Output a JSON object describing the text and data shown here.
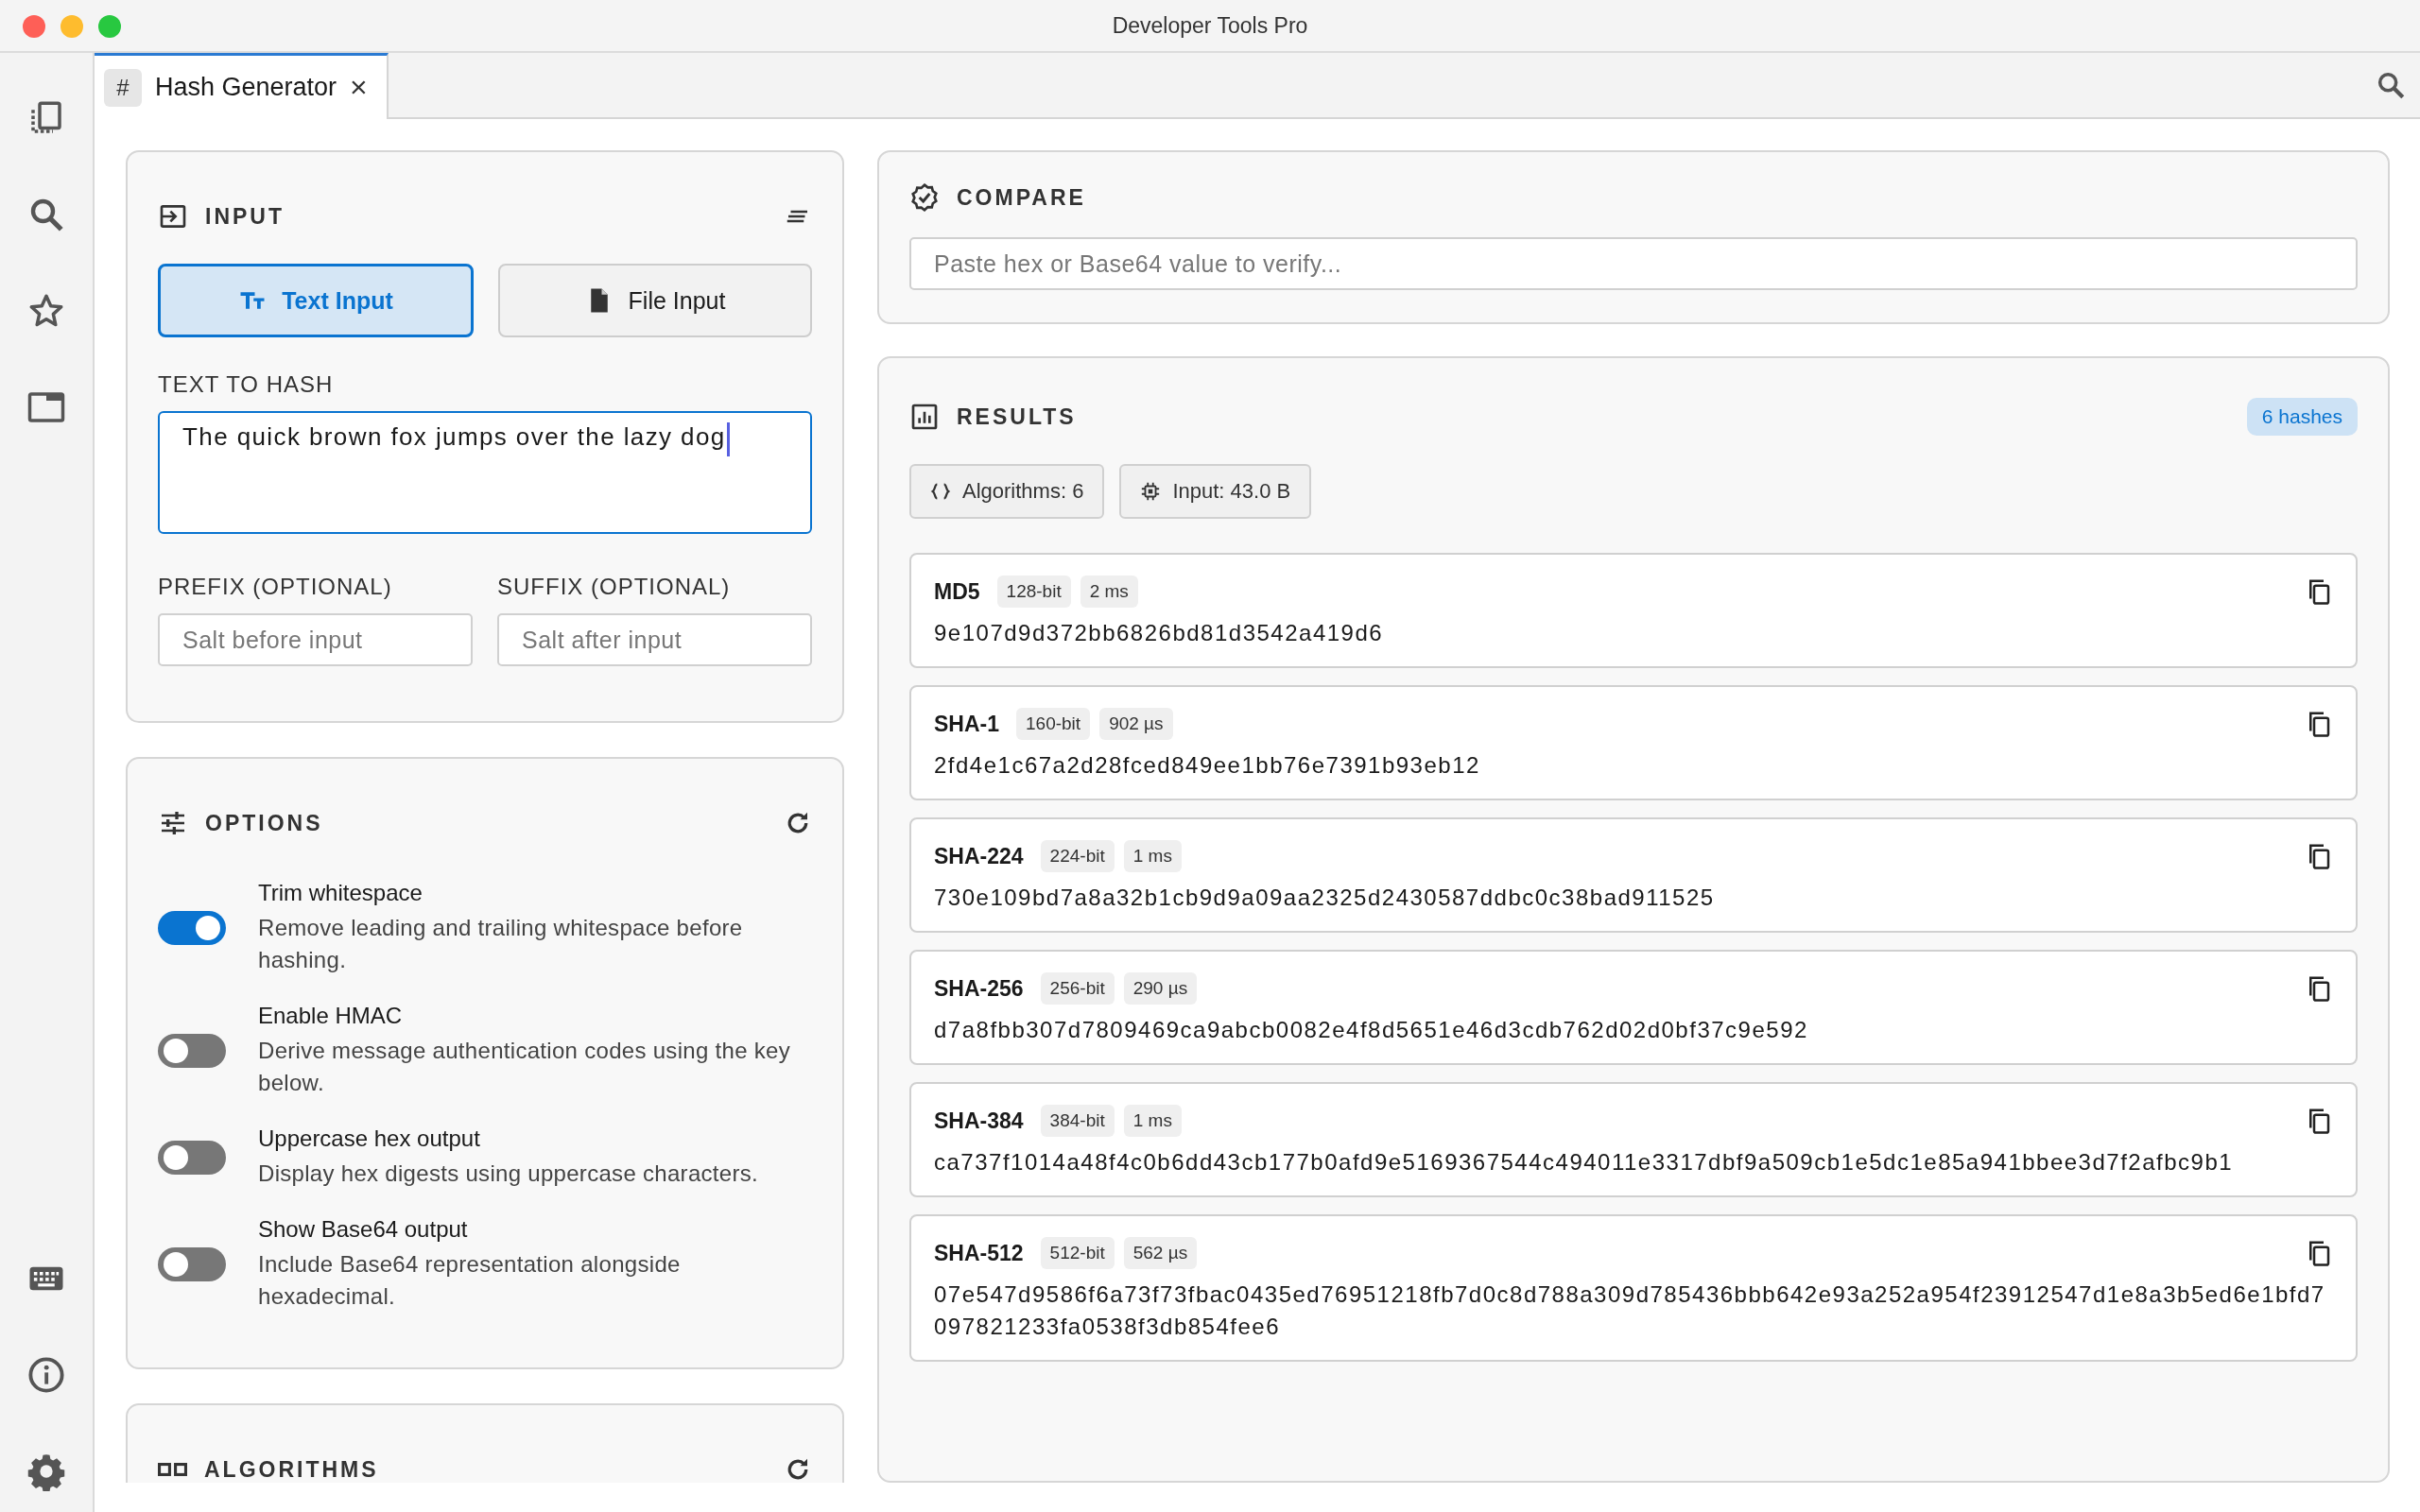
{
  "window": {
    "title": "Developer Tools Pro"
  },
  "tab": {
    "icon": "#",
    "label": "Hash Generator",
    "close": "×",
    "selected": true
  },
  "input": {
    "title": "INPUT",
    "modes": [
      {
        "label": "Text Input",
        "kind": "text",
        "selected": true
      },
      {
        "label": "File Input",
        "kind": "file",
        "selected": false
      }
    ],
    "text_label": "TEXT TO HASH",
    "text_value": "The quick brown fox jumps over the lazy dog",
    "prefix": {
      "label": "PREFIX (OPTIONAL)",
      "placeholder": "Salt before input"
    },
    "suffix": {
      "label": "SUFFIX (OPTIONAL)",
      "placeholder": "Salt after input"
    }
  },
  "options": {
    "title": "OPTIONS",
    "items": [
      {
        "title": "Trim whitespace",
        "description": "Remove leading and trailing whitespace before hashing.",
        "on": true
      },
      {
        "title": "Enable HMAC",
        "description": "Derive message authentication codes using the key below.",
        "on": false
      },
      {
        "title": "Uppercase hex output",
        "description": "Display hex digests using uppercase characters.",
        "on": false
      },
      {
        "title": "Show Base64 output",
        "description": "Include Base64 representation alongside hexadecimal.",
        "on": false
      }
    ]
  },
  "algorithms": {
    "title": "ALGORITHMS"
  },
  "compare": {
    "title": "COMPARE",
    "placeholder": "Paste hex or Base64 value to verify..."
  },
  "results": {
    "title": "RESULTS",
    "badge": "6 hashes",
    "chips": [
      {
        "label": "Algorithms: 6",
        "kind": "braces"
      },
      {
        "label": "Input: 43.0 B",
        "kind": "chip"
      }
    ],
    "hashes": [
      {
        "name": "MD5",
        "bits": "128-bit",
        "time": "2 ms",
        "value": "9e107d9d372bb6826bd81d3542a419d6"
      },
      {
        "name": "SHA-1",
        "bits": "160-bit",
        "time": "902 µs",
        "value": "2fd4e1c67a2d28fced849ee1bb76e7391b93eb12"
      },
      {
        "name": "SHA-224",
        "bits": "224-bit",
        "time": "1 ms",
        "value": "730e109bd7a8a32b1cb9d9a09aa2325d2430587ddbc0c38bad911525"
      },
      {
        "name": "SHA-256",
        "bits": "256-bit",
        "time": "290 µs",
        "value": "d7a8fbb307d7809469ca9abcb0082e4f8d5651e46d3cdb762d02d0bf37c9e592"
      },
      {
        "name": "SHA-384",
        "bits": "384-bit",
        "time": "1 ms",
        "value": "ca737f1014a48f4c0b6dd43cb177b0afd9e5169367544c494011e3317dbf9a509cb1e5dc1e85a941bbee3d7f2afbc9b1"
      },
      {
        "name": "SHA-512",
        "bits": "512-bit",
        "time": "562 µs",
        "value": "07e547d9586f6a73f73fbac0435ed76951218fb7d0c8d788a309d785436bbb642e93a252a954f23912547d1e8a3b5ed6e1bfd7097821233fa0538f3db854fee6"
      }
    ]
  }
}
